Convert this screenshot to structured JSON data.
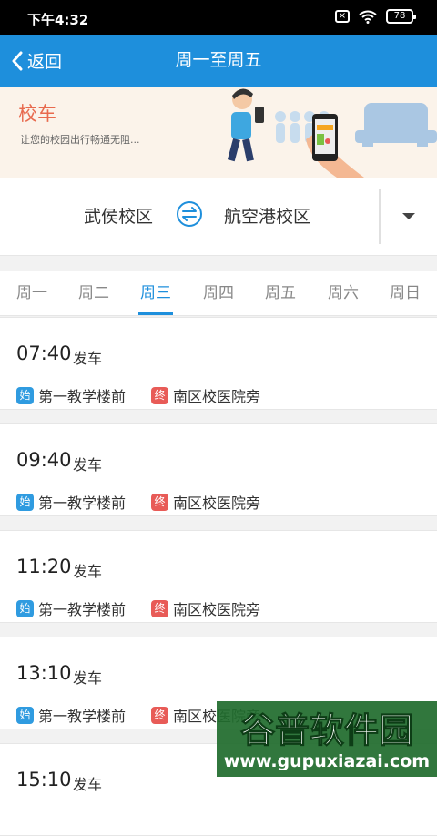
{
  "status_bar": {
    "time": "下午4:32",
    "battery": "78"
  },
  "header": {
    "back_label": "返回",
    "title": "周一至周五"
  },
  "banner": {
    "title": "校车",
    "subtitle": "让您的校园出行畅通无阻..."
  },
  "route": {
    "from": "武侯校区",
    "to": "航空港校区"
  },
  "tabs": [
    {
      "label": "周一",
      "active": false
    },
    {
      "label": "周二",
      "active": false
    },
    {
      "label": "周三",
      "active": true
    },
    {
      "label": "周四",
      "active": false
    },
    {
      "label": "周五",
      "active": false
    },
    {
      "label": "周六",
      "active": false
    },
    {
      "label": "周日",
      "active": false
    }
  ],
  "depart_label": "发车",
  "start_badge": "始",
  "end_badge": "终",
  "schedules": [
    {
      "time": "07:40",
      "start": "第一教学楼前",
      "end": "南区校医院旁"
    },
    {
      "time": "09:40",
      "start": "第一教学楼前",
      "end": "南区校医院旁"
    },
    {
      "time": "11:20",
      "start": "第一教学楼前",
      "end": "南区校医院旁"
    },
    {
      "time": "13:10",
      "start": "第一教学楼前",
      "end": "南区校医院旁"
    },
    {
      "time": "15:10"
    }
  ],
  "watermark": {
    "name": "谷普软件园",
    "url": "www.gupuxiazai.com"
  },
  "colors": {
    "accent": "#1e8fdc",
    "start_badge": "#2f9be0",
    "end_badge": "#e85b57",
    "banner_title": "#e86a4e"
  }
}
